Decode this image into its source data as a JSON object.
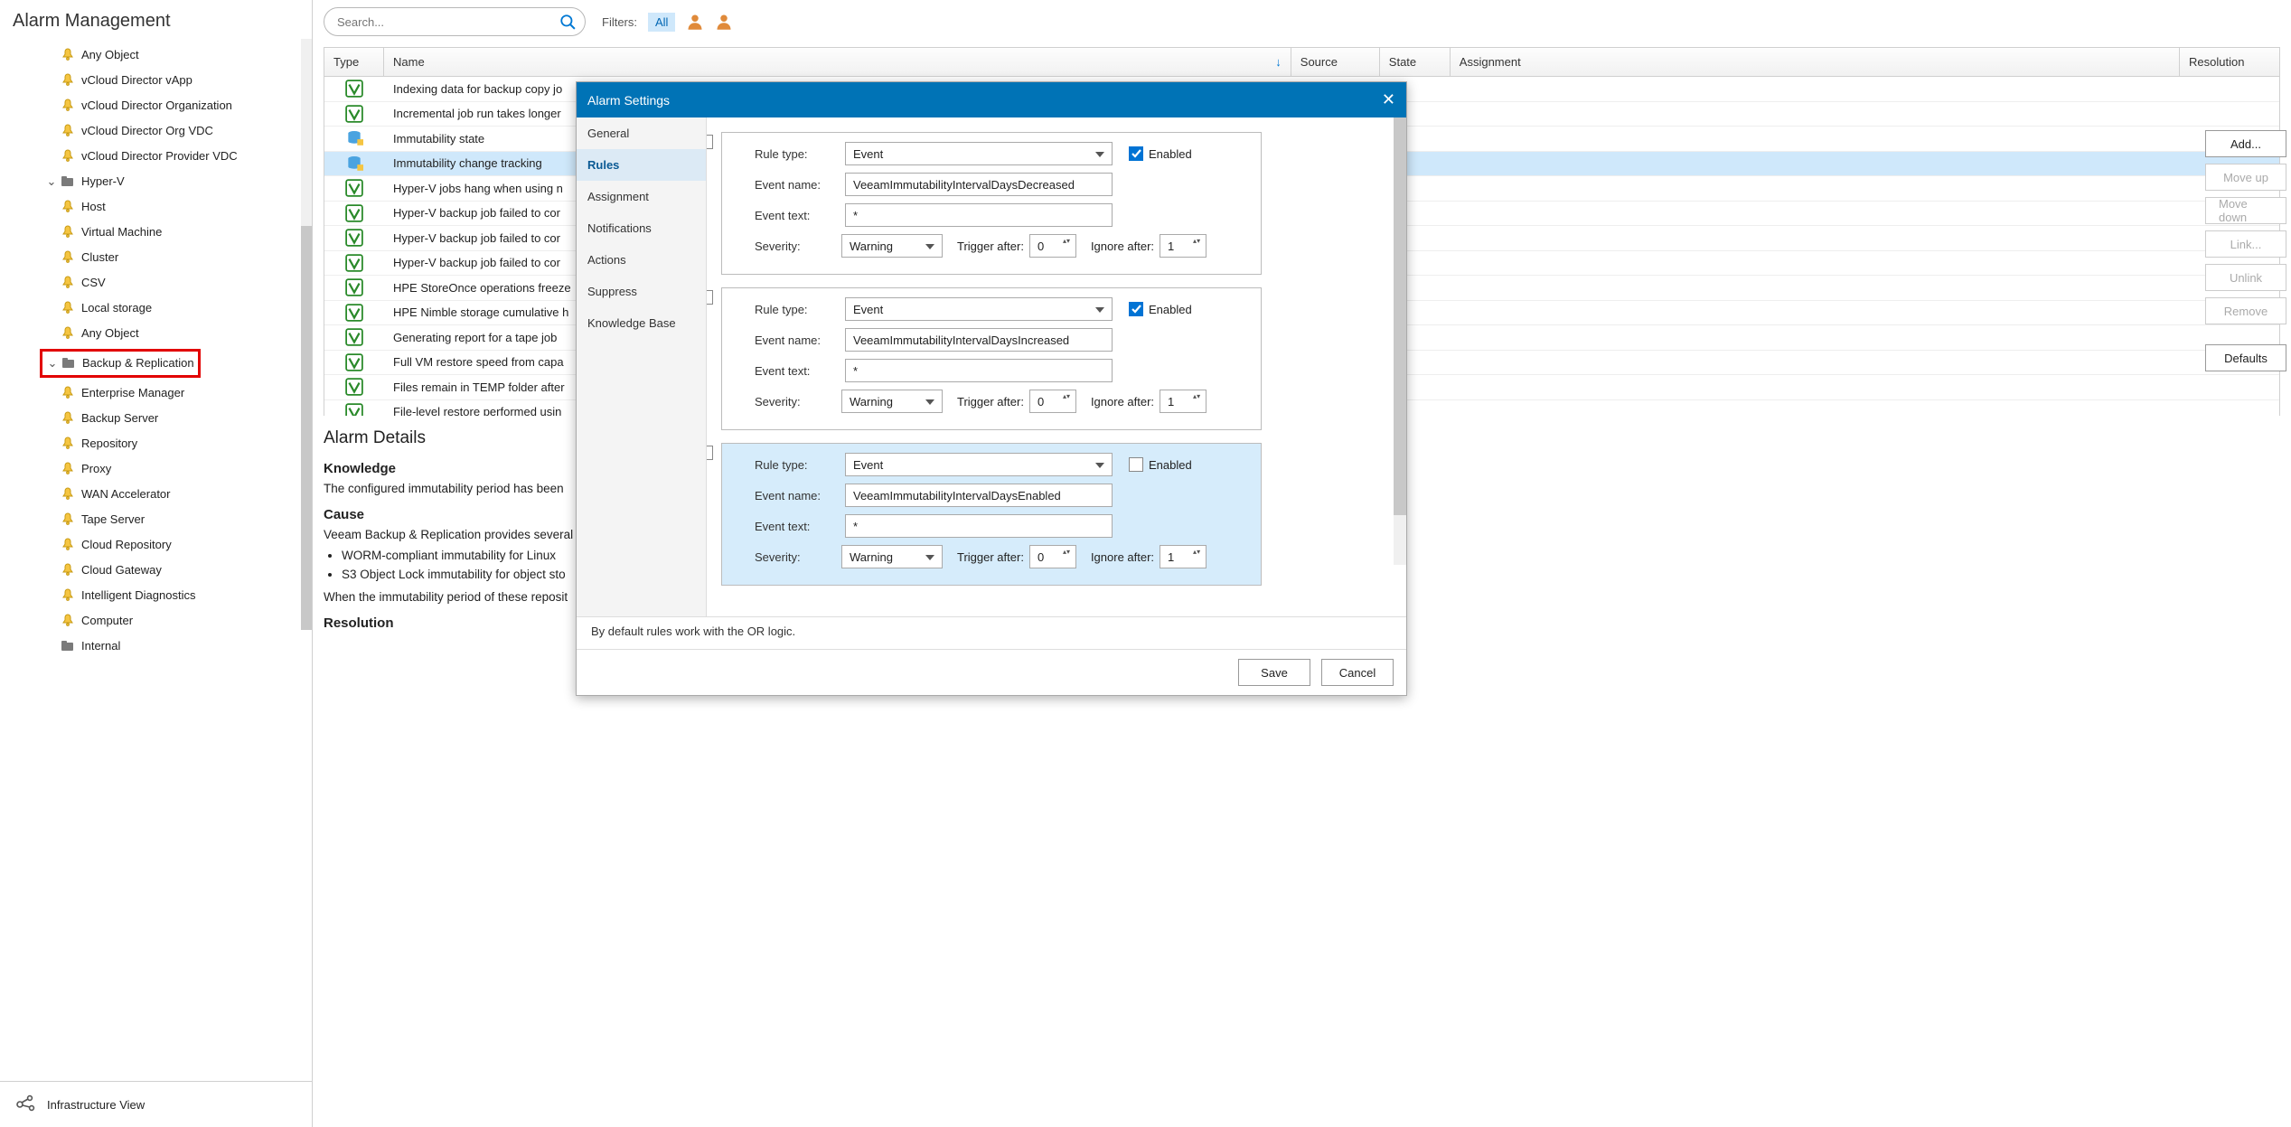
{
  "sidebar": {
    "title": "Alarm Management",
    "items": [
      {
        "label": "Any Object",
        "indent": 2,
        "icon": "bell"
      },
      {
        "label": "vCloud Director vApp",
        "indent": 2,
        "icon": "bell"
      },
      {
        "label": "vCloud Director Organization",
        "indent": 2,
        "icon": "bell"
      },
      {
        "label": "vCloud Director Org VDC",
        "indent": 2,
        "icon": "bell"
      },
      {
        "label": "vCloud Director Provider VDC",
        "indent": 2,
        "icon": "bell"
      },
      {
        "label": "Hyper-V",
        "indent": 1,
        "icon": "folder",
        "exp": "v"
      },
      {
        "label": "Host",
        "indent": 2,
        "icon": "bell"
      },
      {
        "label": "Virtual Machine",
        "indent": 2,
        "icon": "bell"
      },
      {
        "label": "Cluster",
        "indent": 2,
        "icon": "bell"
      },
      {
        "label": "CSV",
        "indent": 2,
        "icon": "bell"
      },
      {
        "label": "Local storage",
        "indent": 2,
        "icon": "bell"
      },
      {
        "label": "Any Object",
        "indent": 2,
        "icon": "bell"
      },
      {
        "label": "Backup & Replication",
        "indent": 1,
        "icon": "folder",
        "exp": "v",
        "hl": true
      },
      {
        "label": "Enterprise Manager",
        "indent": 2,
        "icon": "bell"
      },
      {
        "label": "Backup Server",
        "indent": 2,
        "icon": "bell"
      },
      {
        "label": "Repository",
        "indent": 2,
        "icon": "bell"
      },
      {
        "label": "Proxy",
        "indent": 2,
        "icon": "bell"
      },
      {
        "label": "WAN Accelerator",
        "indent": 2,
        "icon": "bell"
      },
      {
        "label": "Tape Server",
        "indent": 2,
        "icon": "bell"
      },
      {
        "label": "Cloud Repository",
        "indent": 2,
        "icon": "bell"
      },
      {
        "label": "Cloud Gateway",
        "indent": 2,
        "icon": "bell"
      },
      {
        "label": "Intelligent Diagnostics",
        "indent": 2,
        "icon": "bell"
      },
      {
        "label": "Computer",
        "indent": 2,
        "icon": "bell"
      },
      {
        "label": "Internal",
        "indent": 1,
        "icon": "folder"
      }
    ],
    "bottom_nav": {
      "label": "Infrastructure View"
    }
  },
  "toolbar": {
    "search_placeholder": "Search...",
    "filters_label": "Filters:",
    "filter_all": "All"
  },
  "grid": {
    "headers": {
      "type": "Type",
      "name": "Name",
      "source": "Source",
      "state": "State",
      "assignment": "Assignment",
      "resolution": "Resolution"
    },
    "rows": [
      {
        "name": "Indexing data for backup copy jo",
        "icon": "v"
      },
      {
        "name": "Incremental job run takes longer",
        "icon": "v"
      },
      {
        "name": "Immutability state",
        "icon": "db",
        "hl": true
      },
      {
        "name": "Immutability change tracking",
        "icon": "db",
        "sel": true,
        "hl": true
      },
      {
        "name": "Hyper-V jobs hang when using n",
        "icon": "v"
      },
      {
        "name": "Hyper-V backup job failed to cor",
        "icon": "v"
      },
      {
        "name": "Hyper-V backup job failed to cor",
        "icon": "v"
      },
      {
        "name": "Hyper-V backup job failed to cor",
        "icon": "v"
      },
      {
        "name": "HPE StoreOnce operations freeze",
        "icon": "v"
      },
      {
        "name": "HPE Nimble storage cumulative h",
        "icon": "v"
      },
      {
        "name": "Generating report for a tape job",
        "icon": "v"
      },
      {
        "name": "Full VM restore speed from capa",
        "icon": "v"
      },
      {
        "name": "Files remain in TEMP folder after",
        "icon": "v"
      },
      {
        "name": "File-level restore performed usin",
        "icon": "v"
      }
    ]
  },
  "details": {
    "title": "Alarm Details",
    "knowledge_h": "Knowledge",
    "knowledge_p": "The configured immutability period has been",
    "cause_h": "Cause",
    "cause_p": "Veeam Backup & Replication provides several",
    "bullet1": "WORM-compliant immutability for Linux",
    "bullet2": "S3 Object Lock immutability for object sto",
    "after_p": "When the immutability period of these reposit",
    "resolution_h": "Resolution"
  },
  "dialog": {
    "title": "Alarm Settings",
    "tabs": [
      "General",
      "Rules",
      "Assignment",
      "Notifications",
      "Actions",
      "Suppress",
      "Knowledge Base"
    ],
    "active_tab": 1,
    "rules": [
      {
        "rule_type": "Event",
        "event_name": "VeeamImmutabilityIntervalDaysDecreased",
        "event_text": "*",
        "severity": "Warning",
        "trigger_after": "0",
        "ignore_after": "1",
        "enabled": true,
        "sel": false
      },
      {
        "rule_type": "Event",
        "event_name": "VeeamImmutabilityIntervalDaysIncreased",
        "event_text": "*",
        "severity": "Warning",
        "trigger_after": "0",
        "ignore_after": "1",
        "enabled": true,
        "sel": false
      },
      {
        "rule_type": "Event",
        "event_name": "VeeamImmutabilityIntervalDaysEnabled",
        "event_text": "*",
        "severity": "Warning",
        "trigger_after": "0",
        "ignore_after": "1",
        "enabled": false,
        "sel": true
      }
    ],
    "labels": {
      "rule_type": "Rule type:",
      "event_name": "Event name:",
      "event_text": "Event text:",
      "severity": "Severity:",
      "trigger_after": "Trigger after:",
      "ignore_after": "Ignore after:",
      "enabled": "Enabled"
    },
    "hint": "By default rules work with the OR logic.",
    "save": "Save",
    "cancel": "Cancel"
  },
  "side_buttons": {
    "add": "Add...",
    "move_up": "Move up",
    "move_down": "Move down",
    "link": "Link...",
    "unlink": "Unlink",
    "remove": "Remove",
    "defaults": "Defaults"
  }
}
